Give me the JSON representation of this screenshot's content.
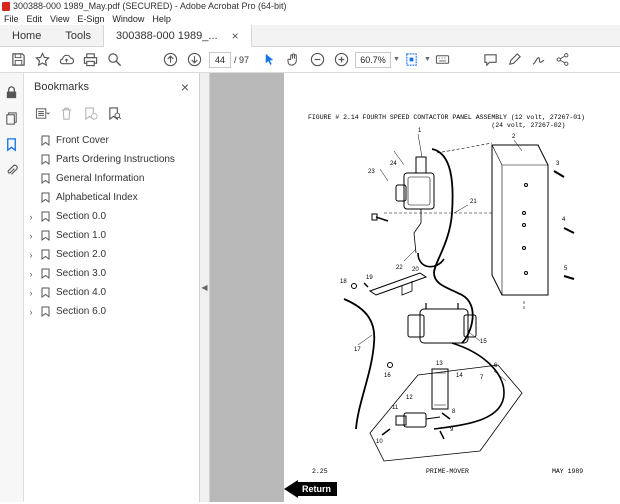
{
  "window": {
    "title": "300388-000 1989_May.pdf (SECURED) - Adobe Acrobat Pro (64-bit)"
  },
  "menu": [
    "File",
    "Edit",
    "View",
    "E-Sign",
    "Window",
    "Help"
  ],
  "tabs": {
    "home": "Home",
    "tools": "Tools",
    "document": "300388-000 1989_...",
    "close": "×"
  },
  "toolbar": {
    "page_current": "44",
    "page_total": "/ 97",
    "zoom": "60.7%"
  },
  "bookmarks": {
    "title": "Bookmarks",
    "close": "×",
    "items": [
      {
        "label": "Front Cover",
        "expandable": false
      },
      {
        "label": "Parts Ordering Instructions",
        "expandable": false
      },
      {
        "label": "General Information",
        "expandable": false
      },
      {
        "label": "Alphabetical Index",
        "expandable": false
      },
      {
        "label": "Section 0.0",
        "expandable": true
      },
      {
        "label": "Section 1.0",
        "expandable": true
      },
      {
        "label": "Section 2.0",
        "expandable": true
      },
      {
        "label": "Section 3.0",
        "expandable": true
      },
      {
        "label": "Section 4.0",
        "expandable": true
      },
      {
        "label": "Section 6.0",
        "expandable": true
      }
    ]
  },
  "splitter": {
    "arrow": "◀"
  },
  "document": {
    "figure_title": "FIGURE # 2.14 FOURTH SPEED CONTACTOR PANEL ASSEMBLY (12 volt, 27267-01)\n                                               (24 volt, 27267-02)",
    "footer_left": "2.25",
    "footer_center": "PRIME-MOVER",
    "footer_right": "MAY 1989",
    "return_label": "Return",
    "callouts": [
      "1",
      "2",
      "3",
      "4",
      "5",
      "6",
      "7",
      "8",
      "9",
      "10",
      "11",
      "12",
      "13",
      "14",
      "15",
      "16",
      "17",
      "18",
      "19",
      "20",
      "21",
      "22",
      "23",
      "24"
    ]
  }
}
